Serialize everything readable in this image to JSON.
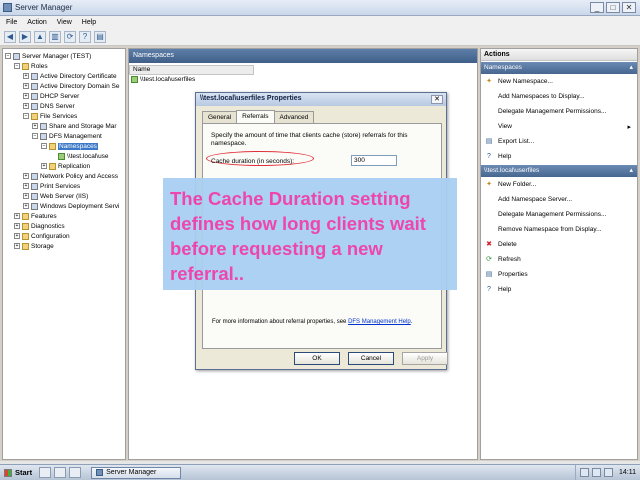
{
  "window": {
    "title": "Server Manager",
    "min": "_",
    "max": "□",
    "close": "✕"
  },
  "menu": [
    "File",
    "Action",
    "View",
    "Help"
  ],
  "toolbar_icons": [
    "back-icon",
    "forward-icon",
    "up-icon",
    "show-hide-tree-icon",
    "refresh-icon",
    "help-icon",
    "properties-icon"
  ],
  "tree": [
    {
      "label": "Server Manager (TEST)",
      "indent": 0,
      "exp": "−",
      "icon": "server"
    },
    {
      "label": "Roles",
      "indent": 1,
      "exp": "−",
      "icon": "folder"
    },
    {
      "label": "Active Directory Certificate",
      "indent": 2,
      "exp": "+",
      "icon": "role"
    },
    {
      "label": "Active Directory Domain Se",
      "indent": 2,
      "exp": "+",
      "icon": "role"
    },
    {
      "label": "DHCP Server",
      "indent": 2,
      "exp": "+",
      "icon": "role"
    },
    {
      "label": "DNS Server",
      "indent": 2,
      "exp": "+",
      "icon": "role"
    },
    {
      "label": "File Services",
      "indent": 2,
      "exp": "−",
      "icon": "folder"
    },
    {
      "label": "Share and Storage Mar",
      "indent": 3,
      "exp": "+",
      "icon": "role"
    },
    {
      "label": "DFS Management",
      "indent": 3,
      "exp": "−",
      "icon": "role"
    },
    {
      "label": "Namespaces",
      "indent": 4,
      "exp": "−",
      "icon": "folder",
      "selected": true
    },
    {
      "label": "\\\\test.local\\use",
      "indent": 5,
      "exp": "",
      "icon": "green"
    },
    {
      "label": "Replication",
      "indent": 4,
      "exp": "+",
      "icon": "folder"
    },
    {
      "label": "Network Policy and Access",
      "indent": 2,
      "exp": "+",
      "icon": "role"
    },
    {
      "label": "Print Services",
      "indent": 2,
      "exp": "+",
      "icon": "role"
    },
    {
      "label": "Web Server (IIS)",
      "indent": 2,
      "exp": "+",
      "icon": "role"
    },
    {
      "label": "Windows Deployment Servi",
      "indent": 2,
      "exp": "+",
      "icon": "role"
    },
    {
      "label": "Features",
      "indent": 1,
      "exp": "+",
      "icon": "folder"
    },
    {
      "label": "Diagnostics",
      "indent": 1,
      "exp": "+",
      "icon": "folder"
    },
    {
      "label": "Configuration",
      "indent": 1,
      "exp": "+",
      "icon": "folder"
    },
    {
      "label": "Storage",
      "indent": 1,
      "exp": "+",
      "icon": "folder"
    }
  ],
  "middle": {
    "header": "Namespaces",
    "column": "Name",
    "row": "\\\\test.local\\userfiles"
  },
  "actions": {
    "title": "Actions",
    "sections": [
      {
        "label": "Namespaces",
        "items": [
          {
            "label": "New Namespace...",
            "icon": "new-namespace-icon",
            "glyph": "✦",
            "color": "#c08a1e"
          },
          {
            "label": "Add Namespaces to Display...",
            "icon": "add-display-icon",
            "glyph": "",
            "color": "#333"
          },
          {
            "label": "Delegate Management Permissions...",
            "icon": "",
            "glyph": "",
            "color": "#333"
          },
          {
            "label": "View",
            "icon": "",
            "glyph": "",
            "color": "#333",
            "submenu": "▸"
          },
          {
            "label": "Export List...",
            "icon": "export-list-icon",
            "glyph": "▤",
            "color": "#2e5a90"
          },
          {
            "label": "Help",
            "icon": "help-icon",
            "glyph": "?",
            "color": "#2e5a90"
          }
        ]
      },
      {
        "label": "\\\\test.local\\userfiles",
        "items": [
          {
            "label": "New Folder...",
            "icon": "new-folder-icon",
            "glyph": "✦",
            "color": "#c08a1e"
          },
          {
            "label": "Add Namespace Server...",
            "icon": "",
            "glyph": "",
            "color": "#333"
          },
          {
            "label": "Delegate Management Permissions...",
            "icon": "",
            "glyph": "",
            "color": "#333"
          },
          {
            "label": "Remove Namespace from Display...",
            "icon": "",
            "glyph": "",
            "color": "#333"
          },
          {
            "label": "Delete",
            "icon": "delete-icon",
            "glyph": "✖",
            "color": "#d0202a"
          },
          {
            "label": "Refresh",
            "icon": "refresh-icon",
            "glyph": "⟳",
            "color": "#2f8f3a"
          },
          {
            "label": "Properties",
            "icon": "properties-icon",
            "glyph": "▤",
            "color": "#2e5a90"
          },
          {
            "label": "Help",
            "icon": "help-icon",
            "glyph": "?",
            "color": "#2e5a90"
          }
        ]
      }
    ]
  },
  "dialog": {
    "title": "\\\\test.local\\userfiles Properties",
    "close": "✕",
    "tabs": [
      "General",
      "Referrals",
      "Advanced"
    ],
    "active_tab": 1,
    "description": "Specify the amount of time that clients cache (store) referrals for this namespace.",
    "field_label": "Cache duration (in seconds):",
    "field_value": "300",
    "help_prefix": "For more information about referral properties, see ",
    "help_link": "DFS Management Help",
    "help_suffix": ".",
    "buttons": {
      "ok": "OK",
      "cancel": "Cancel",
      "apply": "Apply"
    }
  },
  "callout": {
    "text": "The Cache Duration setting defines how long clients wait before requesting a new referral.."
  },
  "taskbar": {
    "start": "Start",
    "task": "Server Manager",
    "clock": "14:11"
  }
}
